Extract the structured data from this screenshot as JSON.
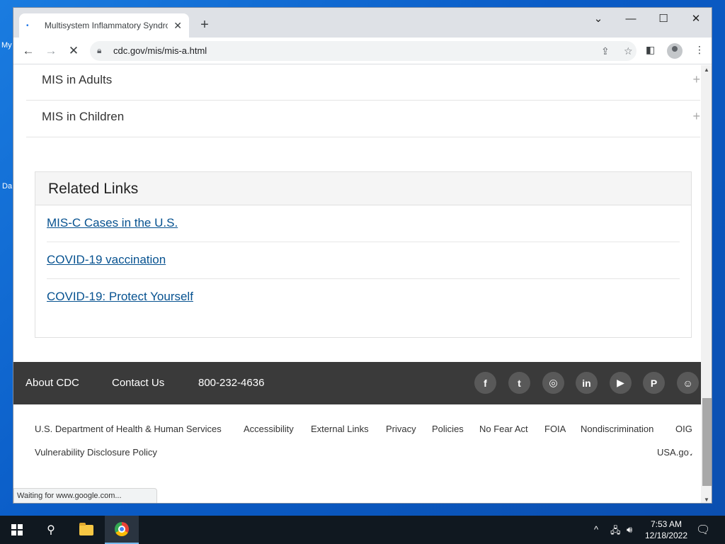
{
  "desktop": {
    "labels": [
      "My",
      "Da"
    ]
  },
  "browser": {
    "tab_title": "Multisystem Inflammatory Syndrome",
    "tab_close": "✕",
    "new_tab": "+",
    "url": "cdc.gov/mis/mis-a.html",
    "status_text": "Waiting for www.google.com..."
  },
  "page": {
    "accordion": [
      {
        "label": "MIS in Adults",
        "icon": "+"
      },
      {
        "label": "MIS in Children",
        "icon": "+"
      }
    ],
    "related": {
      "heading": "Related Links",
      "links": [
        "MIS-C Cases in the U.S.",
        "COVID-19 vaccination",
        "COVID-19: Protect Yourself"
      ]
    },
    "footer_dark": {
      "links": [
        "About CDC",
        "Contact Us",
        "800-232-4636"
      ],
      "social": [
        {
          "name": "facebook",
          "glyph": "f"
        },
        {
          "name": "twitter",
          "glyph": "t"
        },
        {
          "name": "instagram",
          "glyph": "◎"
        },
        {
          "name": "linkedin",
          "glyph": "in"
        },
        {
          "name": "youtube",
          "glyph": "▶"
        },
        {
          "name": "pinterest",
          "glyph": "P"
        },
        {
          "name": "snapchat",
          "glyph": "☺"
        }
      ]
    },
    "footer_light": {
      "row1": [
        "U.S. Department of Health & Human Services",
        "Accessibility",
        "External Links",
        "Privacy",
        "Policies",
        "No Fear Act",
        "FOIA",
        "Nondiscrimination",
        "OIG"
      ],
      "row2_left": "Vulnerability Disclosure Policy",
      "row2_right": "USA.gov"
    }
  },
  "taskbar": {
    "time": "7:53 AM",
    "date": "12/18/2022"
  },
  "colors": {
    "link": "#075290",
    "footer_dark": "#3a3a3a",
    "desktop": "#0a5cc7"
  }
}
